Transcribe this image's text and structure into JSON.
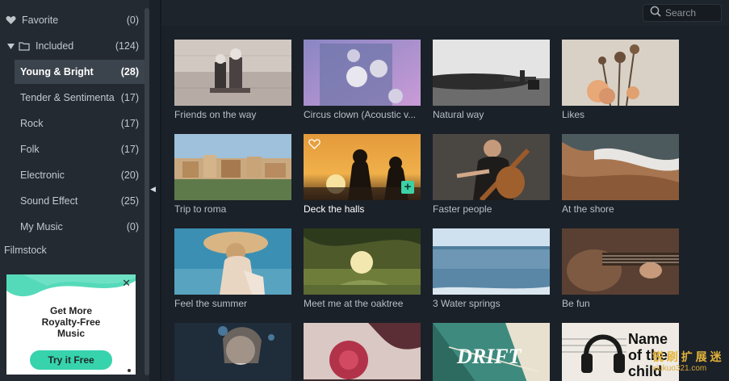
{
  "sidebar": {
    "favorite": {
      "label": "Favorite",
      "count": "(0)"
    },
    "included": {
      "label": "Included",
      "count": "(124)"
    },
    "items": [
      {
        "label": "Young & Bright",
        "count": "(28)"
      },
      {
        "label": "Tender & Sentimenta",
        "count": "(17)"
      },
      {
        "label": "Rock",
        "count": "(17)"
      },
      {
        "label": "Folk",
        "count": "(17)"
      },
      {
        "label": "Electronic",
        "count": "(20)"
      },
      {
        "label": "Sound Effect",
        "count": "(25)"
      },
      {
        "label": "My Music",
        "count": "(0)"
      }
    ],
    "filmstock": "Filmstock"
  },
  "ad": {
    "headline": "Get More\nRoyalty-Free\nMusic",
    "cta": "Try it Free",
    "close": "✕"
  },
  "search": {
    "placeholder": "Search"
  },
  "tiles": [
    {
      "label": "Friends on the way"
    },
    {
      "label": "Circus clown (Acoustic v..."
    },
    {
      "label": "Natural way"
    },
    {
      "label": "Likes"
    },
    {
      "label": "Trip to roma"
    },
    {
      "label": "Deck the halls"
    },
    {
      "label": "Faster people"
    },
    {
      "label": "At the shore"
    },
    {
      "label": "Feel the summer"
    },
    {
      "label": "Meet me at the oaktree"
    },
    {
      "label": "3 Water springs"
    },
    {
      "label": "Be fun"
    },
    {
      "label": ""
    },
    {
      "label": ""
    },
    {
      "label": "DRIFT"
    },
    {
      "label": "Name of the child"
    }
  ],
  "watermark": {
    "line1": "锐 刷 扩 展 迷",
    "line2": "xiukuo321.com"
  },
  "colors": {
    "accent": "#37d3ad",
    "sidebar_bg": "#232a32",
    "content_bg": "#1b2129",
    "active_row": "#3b434c"
  }
}
